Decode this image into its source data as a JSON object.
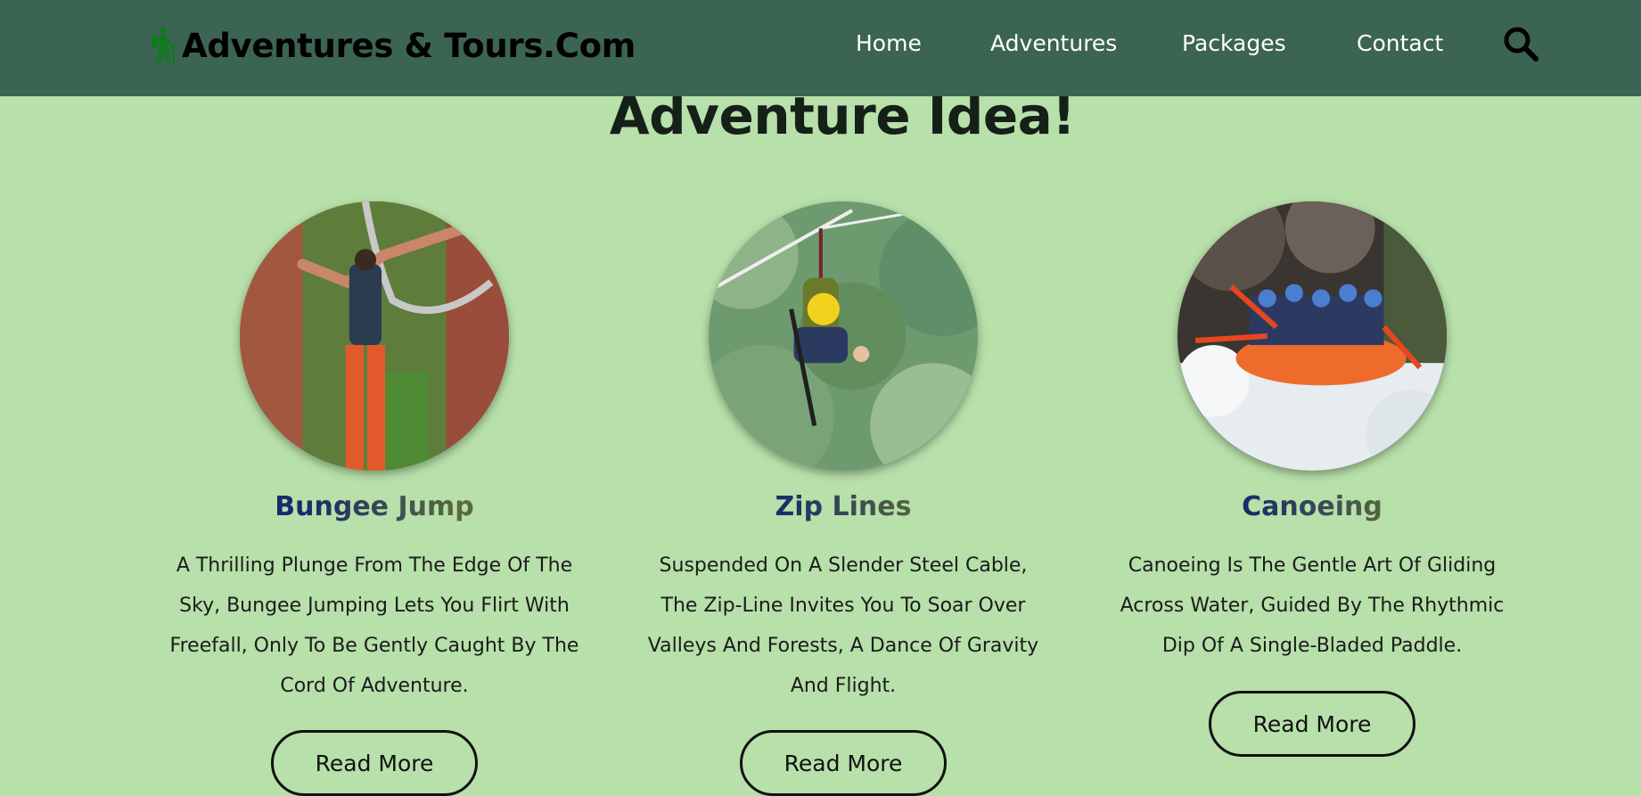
{
  "header": {
    "logo_text": "Adventures & Tours.Com",
    "nav": [
      "Home",
      "Adventures",
      "Packages",
      "Contact"
    ]
  },
  "section": {
    "title": "Adventure Idea!"
  },
  "cards": [
    {
      "title": "Bungee Jump",
      "description": "A Thrilling Plunge From The Edge Of The Sky, Bungee Jumping Lets You Flirt With Freefall, Only To Be Gently Caught By The Cord Of Adventure.",
      "button": "Read More"
    },
    {
      "title": "Zip Lines",
      "description": "Suspended On A Slender Steel Cable, The Zip-Line Invites You To Soar Over Valleys And Forests, A Dance Of Gravity And Flight.",
      "button": "Read More"
    },
    {
      "title": "Canoeing",
      "description": "Canoeing Is The Gentle Art Of Gliding Across Water, Guided By The Rhythmic Dip Of A Single-Bladed Paddle.",
      "button": "Read More"
    }
  ],
  "colors": {
    "header_bg": "#3c6452",
    "page_bg": "#b7e0aa",
    "logo_icon": "#0f7a1e"
  }
}
